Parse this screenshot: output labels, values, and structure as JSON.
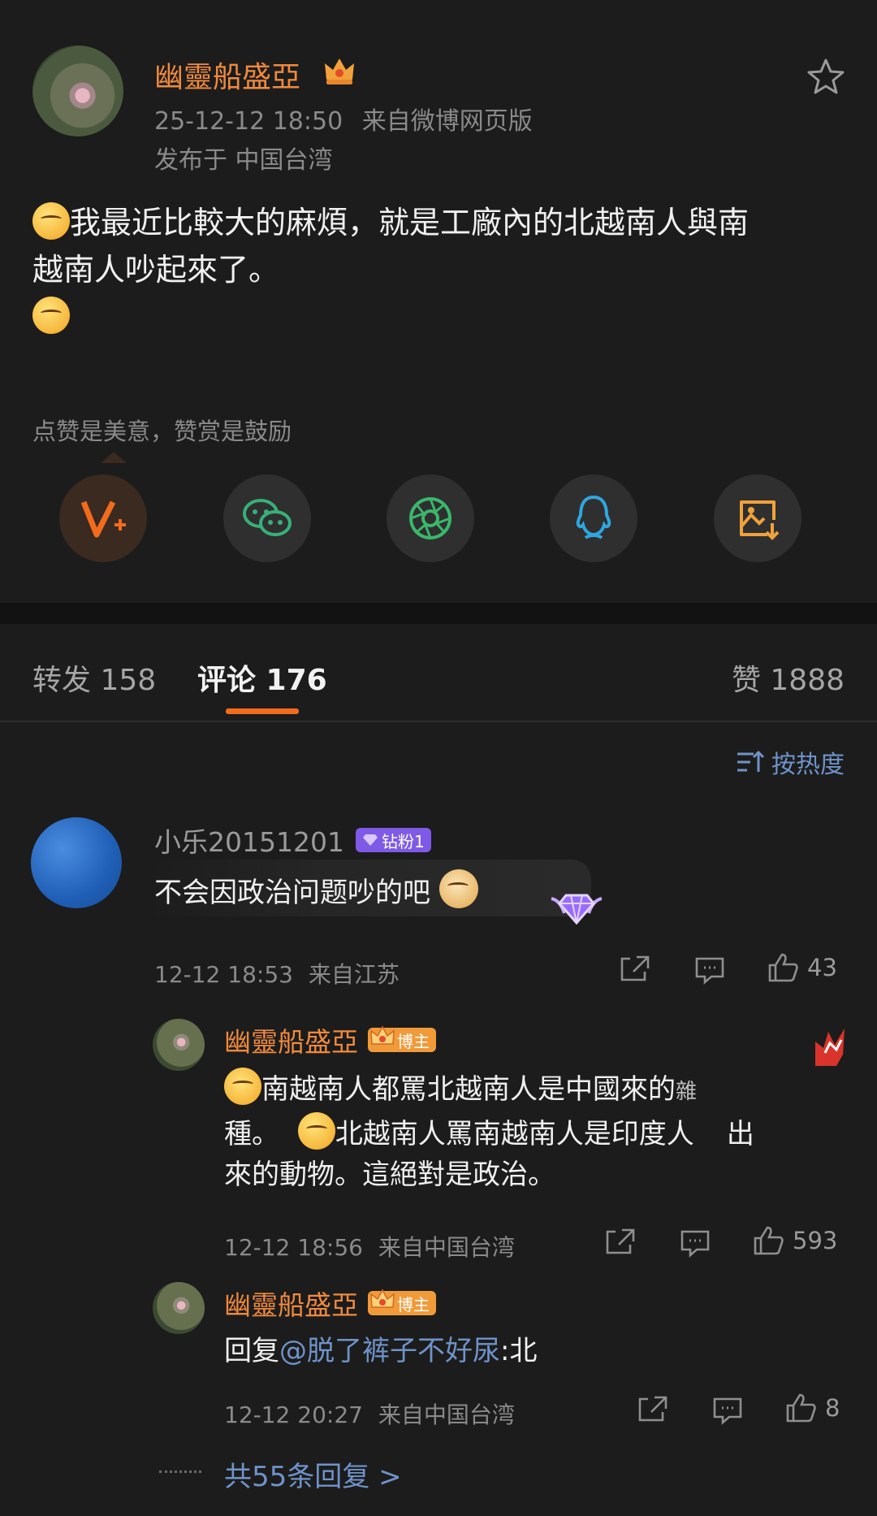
{
  "post": {
    "author": "幽靈船盛亞",
    "timestamp": "25-12-12 18:50",
    "source": "来自微博网页版",
    "location": "发布于 中国台湾",
    "text_line1": "我最近比較大的麻煩，就是工廠內的北越南人與南",
    "text_line2": "越南人吵起來了。",
    "reward_note": "点赞是美意，赞赏是鼓励"
  },
  "share_icons": [
    "v-plus-icon",
    "wechat-icon",
    "moments-icon",
    "qq-icon",
    "save-image-icon"
  ],
  "tabs": {
    "repost": "转发 158",
    "comments": "评论 176",
    "likes": "赞 1888"
  },
  "sort_label": "按热度",
  "comment": {
    "user": "小乐20151201",
    "badge": "钻粉1",
    "text": "不会因政治问题吵的吧",
    "time": "12-12 18:53",
    "location": "来自江苏",
    "likes": "43"
  },
  "replies": [
    {
      "user": "幽靈船盛亞",
      "badge": "博主",
      "line1": "南越南人都罵北越南人是中國來的",
      "line1_tail": "雜",
      "line2a": "種。",
      "line2b": "北越南人罵南越南人是印度人",
      "line2_tail": "出",
      "line3": "來的動物。這絕對是政治。",
      "time": "12-12 18:56",
      "location": "来自中国台湾",
      "likes": "593"
    },
    {
      "user": "幽靈船盛亞",
      "badge": "博主",
      "prefix": "回复",
      "mention": "@脱了裤子不好尿",
      "suffix": ":北",
      "time": "12-12 20:27",
      "location": "来自中国台湾",
      "likes": "8"
    }
  ],
  "more_replies": "共55条回复 >",
  "colors": {
    "accent": "#f08a3d",
    "link": "#6f93c9",
    "tab_underline": "#f26b1d"
  }
}
